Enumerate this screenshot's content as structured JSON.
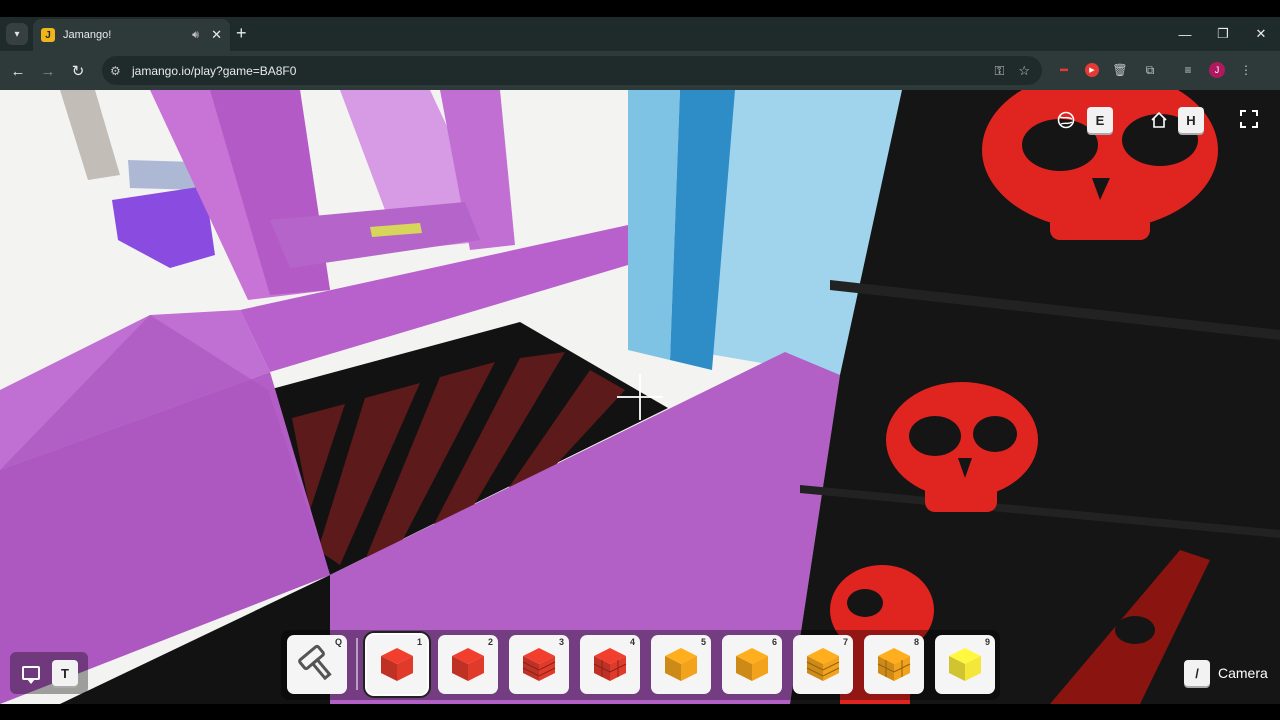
{
  "browser": {
    "tab_title": "Jamango!",
    "url": "jamango.io/play?game=BA8F0",
    "profile_initial": "J",
    "icons": [
      "tab-menu-icon",
      "speaker-icon",
      "close-icon",
      "plus-icon",
      "back-icon",
      "forward-icon",
      "reload-icon",
      "site-settings-icon",
      "password-key-icon",
      "star-icon",
      "extension-icon",
      "media-icon"
    ]
  },
  "hud": {
    "editor_key": "E",
    "home_key": "H",
    "chat_key": "T",
    "camera_key": "/",
    "camera_label": "Camera",
    "icons": [
      "globe-icon",
      "home-icon",
      "fullscreen-icon",
      "chat-icon"
    ]
  },
  "hotbar": {
    "selected_index": 1,
    "slots": [
      {
        "key": "Q",
        "item": "hammer-tool",
        "color": "#555555"
      },
      {
        "key": "1",
        "item": "red-block",
        "color": "#e03a2a"
      },
      {
        "key": "2",
        "item": "red-block",
        "color": "#e03a2a"
      },
      {
        "key": "3",
        "item": "red-brick-block",
        "color": "#e03a2a"
      },
      {
        "key": "4",
        "item": "red-tile-block",
        "color": "#e03a2a"
      },
      {
        "key": "5",
        "item": "orange-block",
        "color": "#f2a21b"
      },
      {
        "key": "6",
        "item": "orange-block",
        "color": "#f2a21b"
      },
      {
        "key": "7",
        "item": "orange-brick-block",
        "color": "#f2a21b"
      },
      {
        "key": "8",
        "item": "orange-tile-block",
        "color": "#f2a21b"
      },
      {
        "key": "9",
        "item": "yellow-block",
        "color": "#f5e63a"
      }
    ]
  },
  "colors": {
    "purple": "#b560c8",
    "light_blue": "#8ccbe6",
    "skull_red": "#e0241f",
    "hazard_black": "#121212"
  }
}
